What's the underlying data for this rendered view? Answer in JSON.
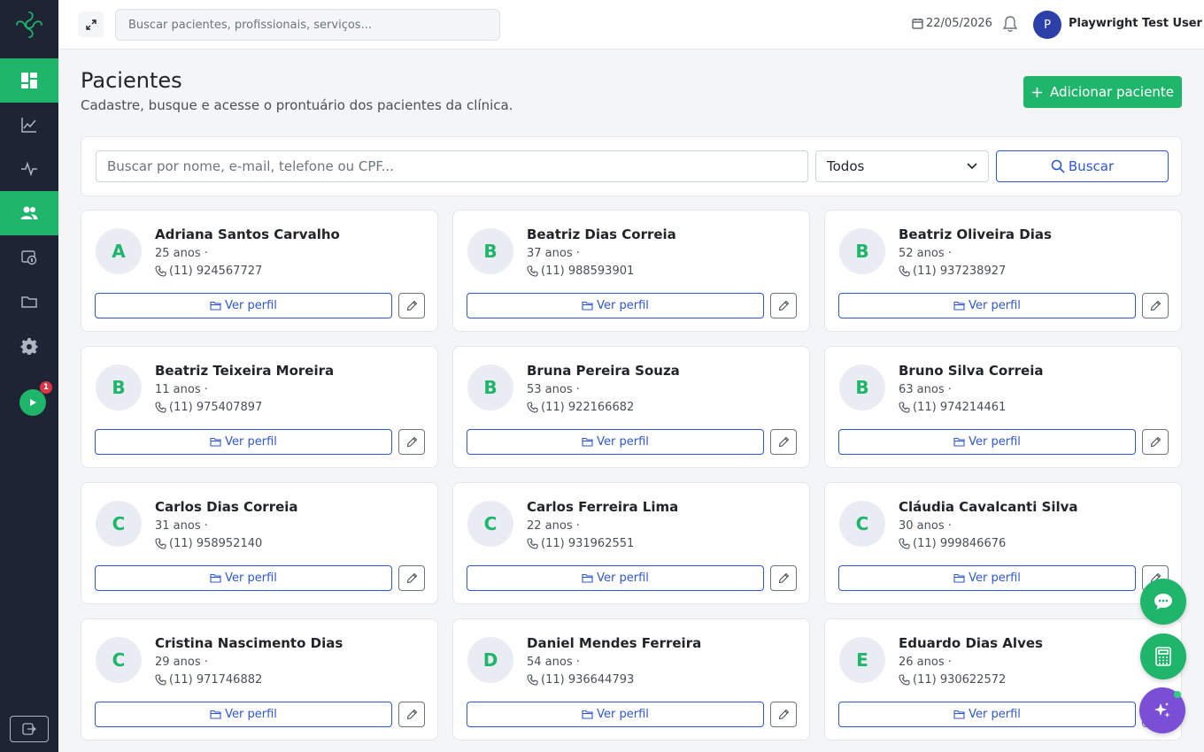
{
  "topbar": {
    "search_placeholder": "Buscar pacientes, profissionais, serviços...",
    "date": "22/05/2026",
    "avatar_initial": "P",
    "user_name": "Playwright Test User"
  },
  "sidebar": {
    "items": [
      "dashboard",
      "analytics",
      "activity",
      "patients",
      "finance",
      "files",
      "settings"
    ],
    "active": "patients",
    "notification_count": "1"
  },
  "page": {
    "title": "Pacientes",
    "subtitle": "Cadastre, busque e acesse o prontuário dos pacientes da clínica.",
    "add_button": "Adicionar paciente"
  },
  "filter": {
    "search_placeholder": "Buscar por nome, e-mail, telefone ou CPF...",
    "select_value": "Todos",
    "search_button": "Buscar"
  },
  "card_labels": {
    "view": "Ver perfil"
  },
  "patients": [
    {
      "initial": "A",
      "name": "Adriana Santos Carvalho",
      "age": "25 anos ·",
      "phone": "(11) 924567727"
    },
    {
      "initial": "B",
      "name": "Beatriz Dias Correia",
      "age": "37 anos ·",
      "phone": "(11) 988593901"
    },
    {
      "initial": "B",
      "name": "Beatriz Oliveira Dias",
      "age": "52 anos ·",
      "phone": "(11) 937238927"
    },
    {
      "initial": "B",
      "name": "Beatriz Teixeira Moreira",
      "age": "11 anos ·",
      "phone": "(11) 975407897"
    },
    {
      "initial": "B",
      "name": "Bruna Pereira Souza",
      "age": "53 anos ·",
      "phone": "(11) 922166682"
    },
    {
      "initial": "B",
      "name": "Bruno Silva Correia",
      "age": "63 anos ·",
      "phone": "(11) 974214461"
    },
    {
      "initial": "C",
      "name": "Carlos Dias Correia",
      "age": "31 anos ·",
      "phone": "(11) 958952140"
    },
    {
      "initial": "C",
      "name": "Carlos Ferreira Lima",
      "age": "22 anos ·",
      "phone": "(11) 931962551"
    },
    {
      "initial": "C",
      "name": "Cláudia Cavalcanti Silva",
      "age": "30 anos ·",
      "phone": "(11) 999846676"
    },
    {
      "initial": "C",
      "name": "Cristina Nascimento Dias",
      "age": "29 anos ·",
      "phone": "(11) 971746882"
    },
    {
      "initial": "D",
      "name": "Daniel Mendes Ferreira",
      "age": "54 anos ·",
      "phone": "(11) 936644793"
    },
    {
      "initial": "E",
      "name": "Eduardo Dias Alves",
      "age": "26 anos ·",
      "phone": "(11) 930622572"
    }
  ],
  "colors": {
    "brand_green": "#1fb56b",
    "sidebar_bg": "#1e2433",
    "link_blue": "#2d56d8",
    "ai_purple": "#7a4fd6"
  }
}
